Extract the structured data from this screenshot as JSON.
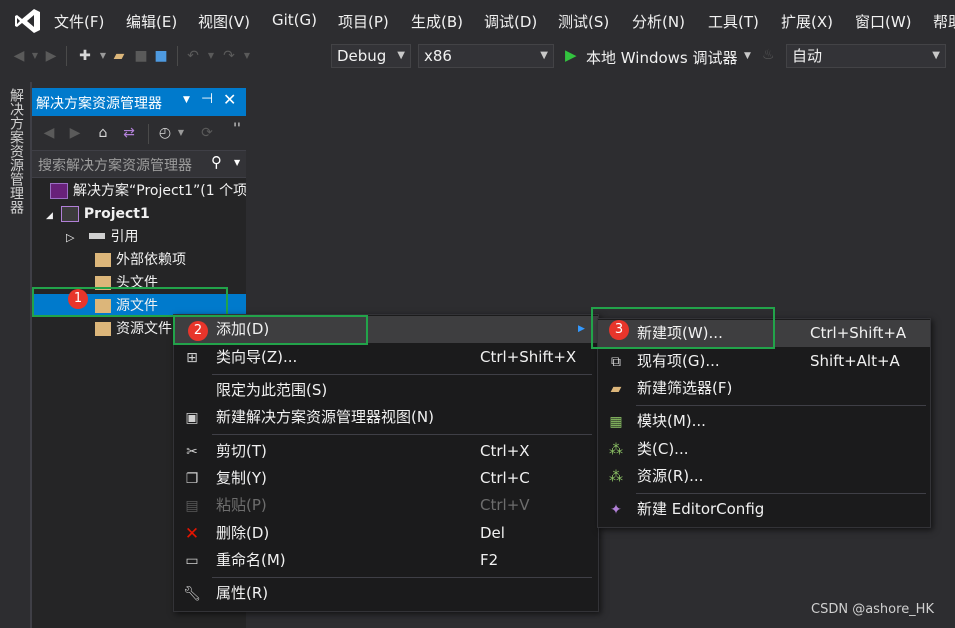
{
  "menubar": {
    "items": [
      "文件(F)",
      "编辑(E)",
      "视图(V)",
      "Git(G)",
      "项目(P)",
      "生成(B)",
      "调试(D)",
      "测试(S)",
      "分析(N)",
      "工具(T)",
      "扩展(X)",
      "窗口(W)",
      "帮助"
    ]
  },
  "toolbar": {
    "configuration": "Debug",
    "platform": "x86",
    "debugger": "本地 Windows 调试器",
    "target": "自动"
  },
  "side_tab": {
    "label": "解决方案资源管理器"
  },
  "solution_explorer": {
    "title": "解决方案资源管理器",
    "search_placeholder": "搜索解决方案资源管理器",
    "tree": {
      "solution": "解决方案“Project1”(1 个项",
      "project": "Project1",
      "references": "引用",
      "external_deps": "外部依赖项",
      "header_files": "头文件",
      "source_files": "源文件",
      "resource_files": "资源文件"
    }
  },
  "context_menu": {
    "add": "添加(D)",
    "class_wizard": "类向导(Z)...",
    "class_wizard_shortcut": "Ctrl+Shift+X",
    "scope_to_this": "限定为此范围(S)",
    "new_view": "新建解决方案资源管理器视图(N)",
    "cut": "剪切(T)",
    "cut_shortcut": "Ctrl+X",
    "copy": "复制(Y)",
    "copy_shortcut": "Ctrl+C",
    "paste": "粘贴(P)",
    "paste_shortcut": "Ctrl+V",
    "delete": "删除(D)",
    "delete_shortcut": "Del",
    "rename": "重命名(M)",
    "rename_shortcut": "F2",
    "properties": "属性(R)"
  },
  "submenu": {
    "new_item": "新建项(W)...",
    "new_item_shortcut": "Ctrl+Shift+A",
    "existing_item": "现有项(G)...",
    "existing_item_shortcut": "Shift+Alt+A",
    "new_filter": "新建筛选器(F)",
    "module": "模块(M)...",
    "class": "类(C)...",
    "resource": "资源(R)...",
    "editorconfig": "新建 EditorConfig"
  },
  "badges": [
    "1",
    "2",
    "3"
  ],
  "watermark": "CSDN @ashore_HK",
  "colors": {
    "accent": "#007acc",
    "highlight_box": "#22a34a",
    "badge": "#e8352b"
  }
}
